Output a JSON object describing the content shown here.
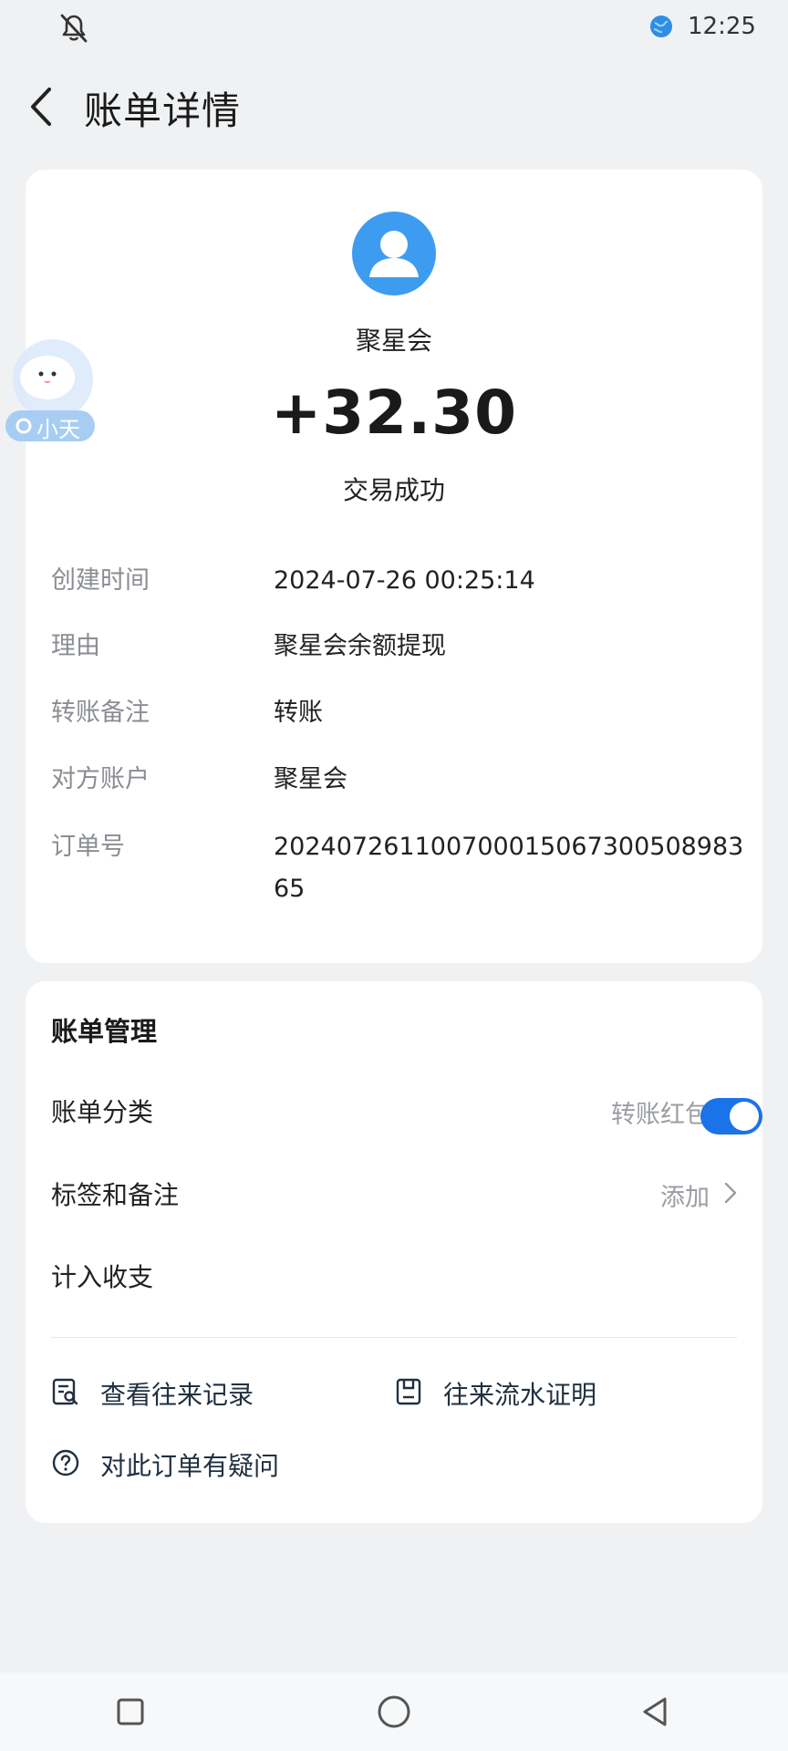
{
  "status_bar": {
    "time": "12:25"
  },
  "header": {
    "title": "账单详情"
  },
  "summary": {
    "merchant": "聚星会",
    "amount": "+32.30",
    "status": "交易成功"
  },
  "details": [
    {
      "label": "创建时间",
      "value": "2024-07-26 00:25:14"
    },
    {
      "label": "理由",
      "value": "聚星会余额提现"
    },
    {
      "label": "转账备注",
      "value": "转账"
    },
    {
      "label": "对方账户",
      "value": "聚星会"
    },
    {
      "label": "订单号",
      "value": "20240726110070001506730050898365"
    }
  ],
  "floating_assistant": {
    "label": "小天"
  },
  "manage": {
    "title": "账单管理",
    "category_label": "账单分类",
    "category_value": "转账红包",
    "tags_label": "标签和备注",
    "tags_value": "添加",
    "include_label": "计入收支",
    "include_enabled": true,
    "view_records": "查看往来记录",
    "statement": "往来流水证明",
    "question": "对此订单有疑问"
  },
  "colors": {
    "accent": "#1a73e8",
    "avatar": "#3e9cf0",
    "background": "#eff1f3"
  },
  "icons": [
    "notifications-off-icon",
    "globe-icon",
    "back-arrow-icon",
    "user-avatar-icon",
    "chevron-right-icon",
    "records-search-icon",
    "document-icon",
    "question-icon",
    "square-nav-icon",
    "circle-nav-icon",
    "triangle-back-nav-icon"
  ]
}
